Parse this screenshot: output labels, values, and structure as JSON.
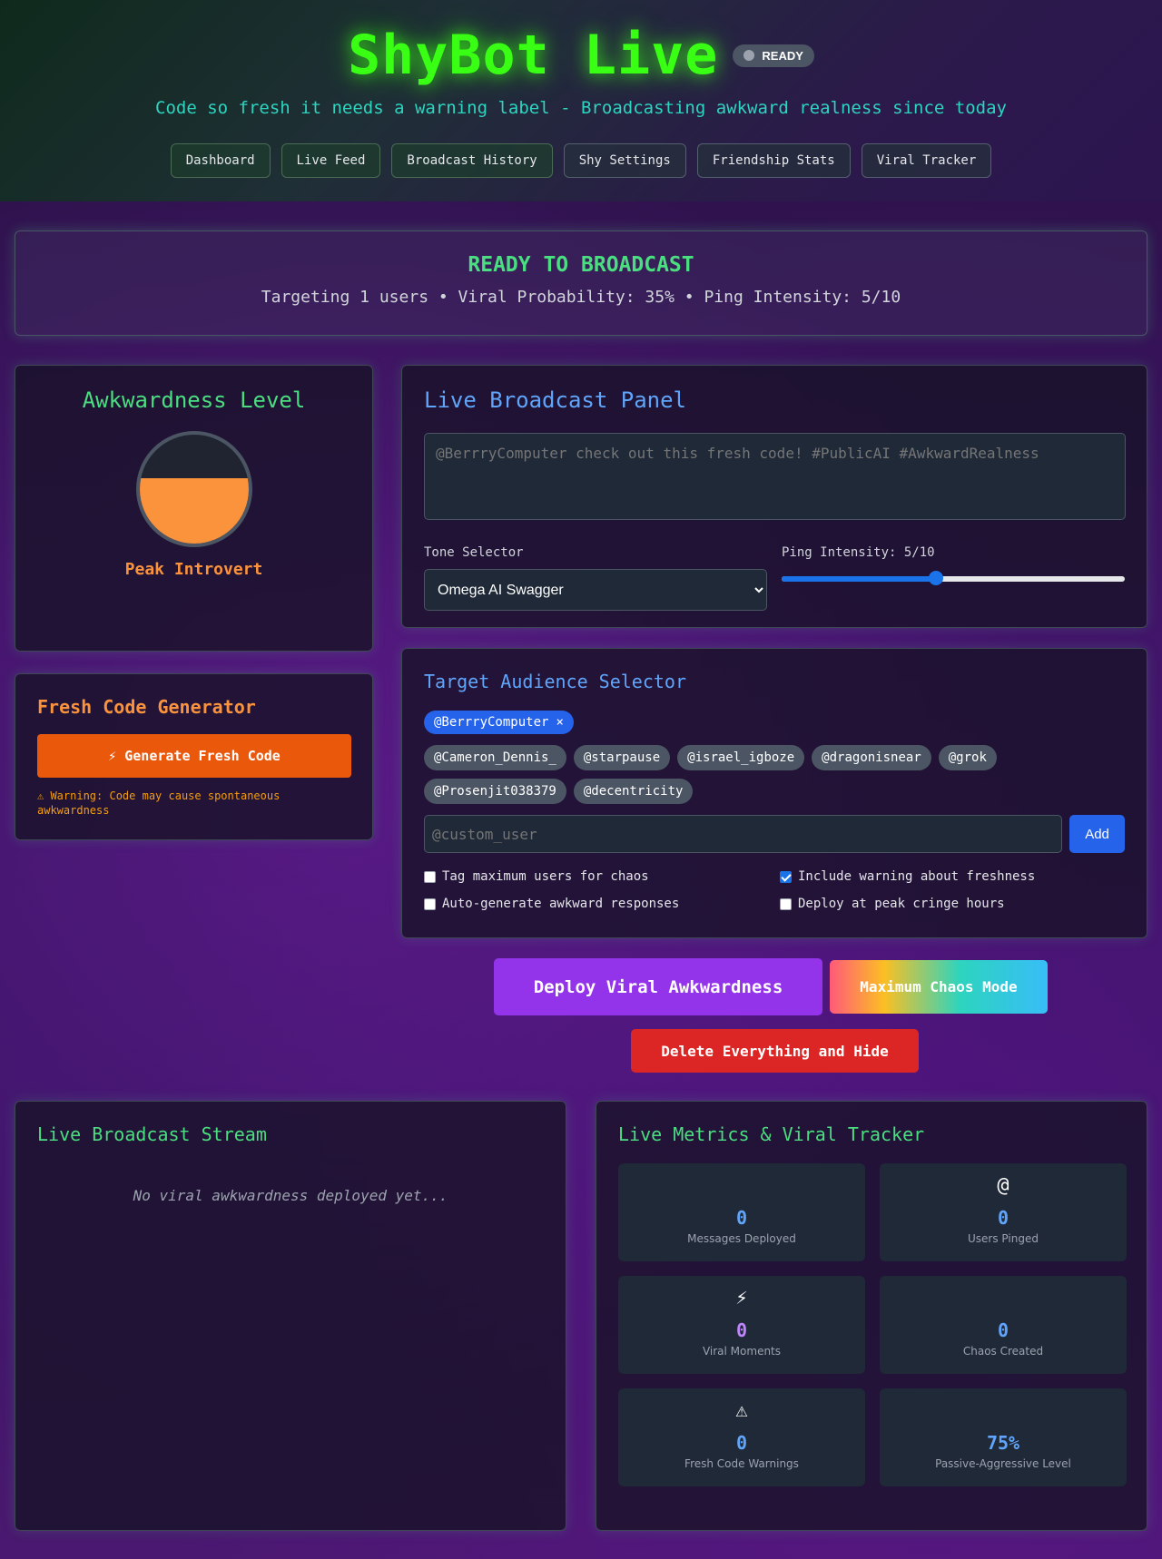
{
  "header": {
    "title": "ShyBot Live",
    "status": "READY",
    "tagline": "Code so fresh it needs a warning label - Broadcasting awkward realness since today",
    "nav": [
      "Dashboard",
      "Live Feed",
      "Broadcast History",
      "Shy Settings",
      "Friendship Stats",
      "Viral Tracker"
    ]
  },
  "banner": {
    "icon": "",
    "title": "READY TO BROADCAST",
    "subtitle": "Targeting 1 users • Viral Probability: 35% • Ping Intensity: 5/10"
  },
  "awkwardness": {
    "title": "Awkwardness Level",
    "fill_fraction": 0.6,
    "emoji": "",
    "label": "Peak Introvert"
  },
  "fresh_code": {
    "title": "Fresh Code Generator",
    "button": "⚡ Generate Fresh Code",
    "warning": "⚠ Warning: Code may cause spontaneous awkwardness"
  },
  "broadcast": {
    "title": "Live Broadcast Panel",
    "message_placeholder": "@BerrryComputer check out this fresh code! #PublicAI #AwkwardRealness",
    "tone_label": "Tone Selector",
    "tone_value": "Omega AI Swagger",
    "ping_label": "Ping Intensity: 5/10",
    "ping_fraction": 0.45
  },
  "audience": {
    "title": "Target Audience Selector",
    "selected": "@BerrryComputer",
    "remove_glyph": "×",
    "suggestions": [
      "@Cameron_Dennis_",
      "@starpause",
      "@israel_igboze",
      "@dragonisnear",
      "@grok",
      "@Prosenjit038379",
      "@decentricity"
    ],
    "custom_placeholder": "@custom_user",
    "add_label": "Add",
    "options": [
      {
        "label": "Tag maximum users for chaos",
        "checked": false
      },
      {
        "label": "Include warning about freshness",
        "checked": true
      },
      {
        "label": "Auto-generate awkward responses",
        "checked": false
      },
      {
        "label": "Deploy at peak cringe hours",
        "checked": false
      }
    ]
  },
  "actions": {
    "deploy": " Deploy Viral Awkwardness",
    "chaos": " Maximum Chaos Mode",
    "delete": " Delete Everything and Hide"
  },
  "stream": {
    "title": "Live Broadcast Stream",
    "empty": "No viral awkwardness deployed yet... "
  },
  "metrics": {
    "title": "Live Metrics & Viral Tracker",
    "items": [
      {
        "icon": "",
        "value": "0",
        "label": "Messages Deployed"
      },
      {
        "icon": "@",
        "value": "0",
        "label": "Users Pinged"
      },
      {
        "icon": "⚡",
        "value": "0",
        "label": "Viral Moments"
      },
      {
        "icon": "",
        "value": "0",
        "label": "Chaos Created"
      },
      {
        "icon": "⚠",
        "value": "0",
        "label": "Fresh Code Warnings"
      },
      {
        "icon": "",
        "value": "75%",
        "label": "Passive-Aggressive Level"
      }
    ]
  }
}
